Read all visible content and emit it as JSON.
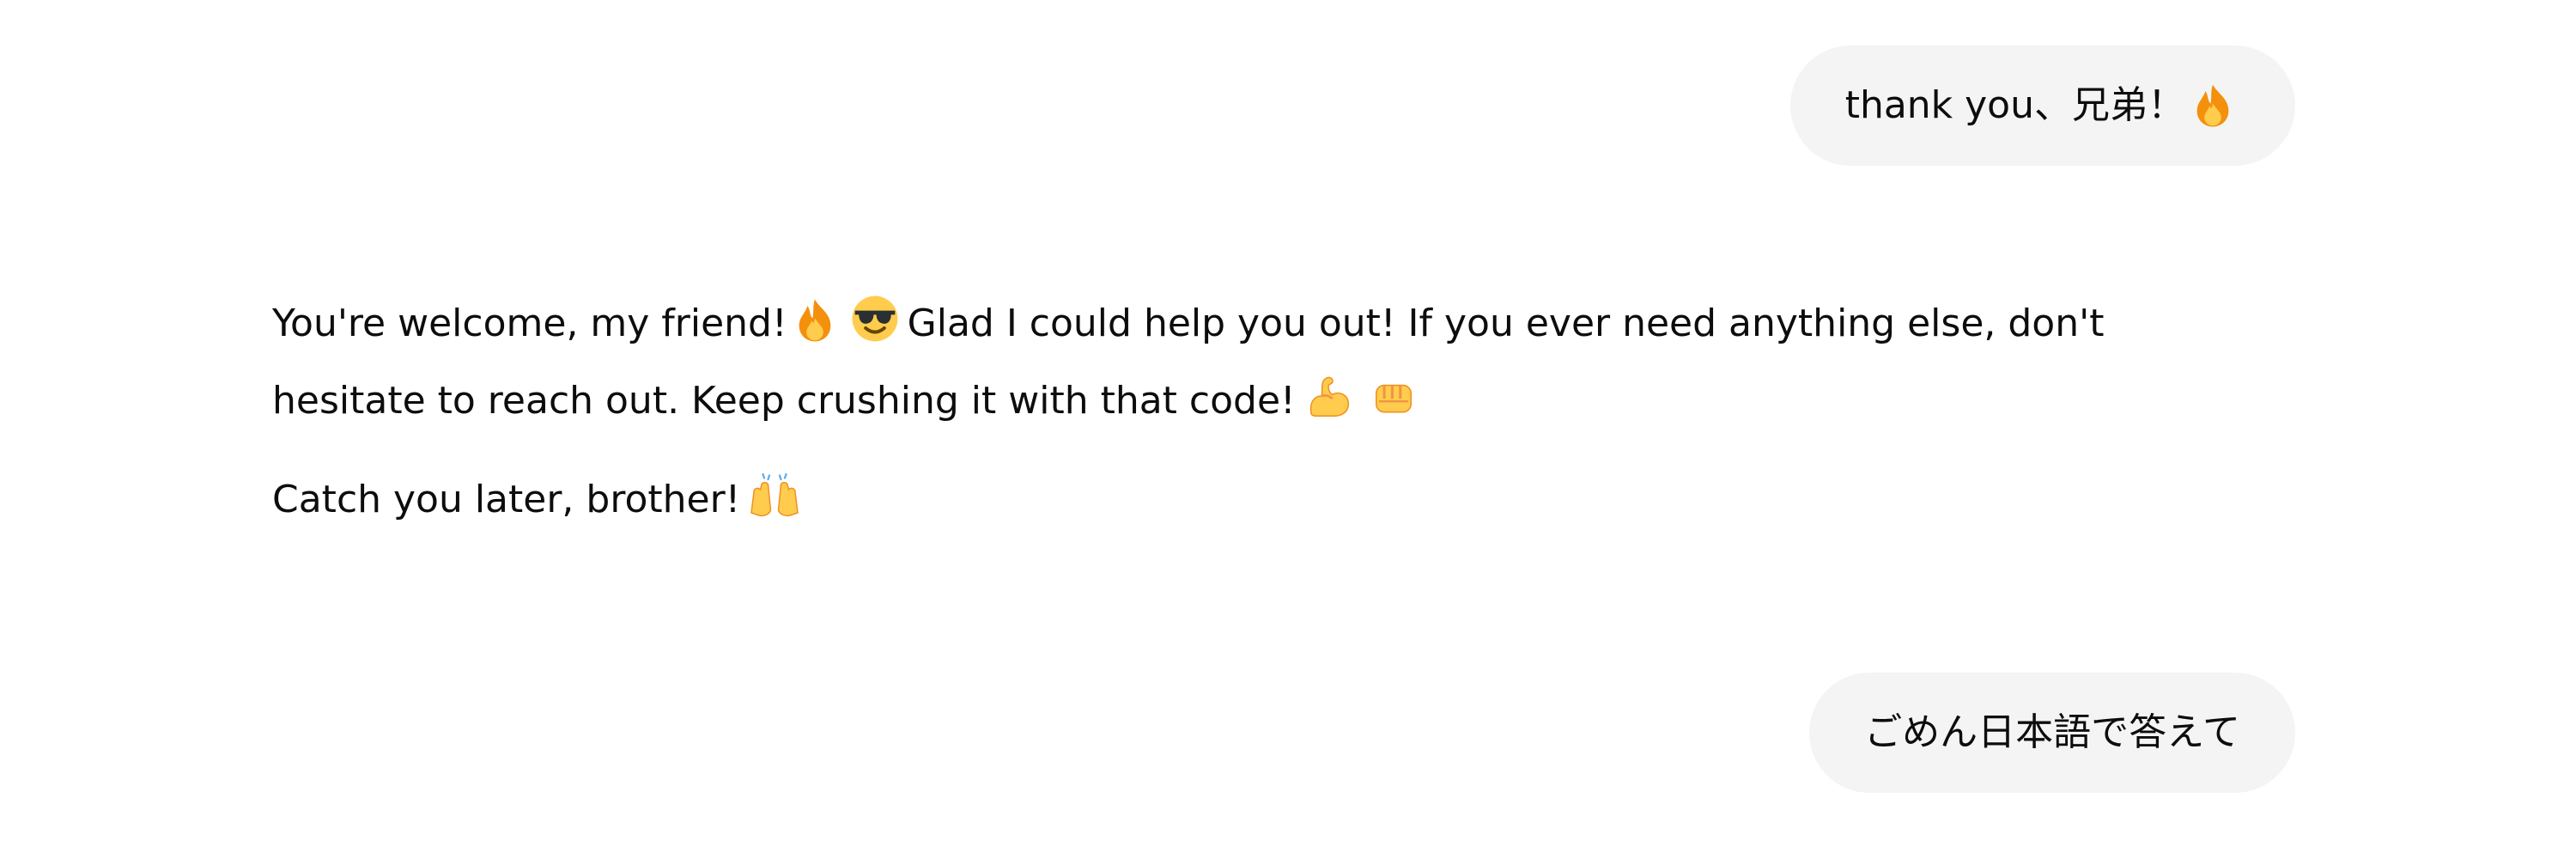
{
  "conversation": {
    "user_message_1": {
      "text": "thank you、兄弟！",
      "emoji_icon": "fire-icon"
    },
    "assistant_reply": {
      "paragraph_1": {
        "text_a": "You're welcome, my friend!",
        "emoji_a": [
          "fire-icon",
          "smiling-face-with-sunglasses-icon"
        ],
        "text_b": "Glad I could help you out! If you ever need anything else, don't hesitate to reach out. Keep crushing it with that code!",
        "emoji_b": [
          "flexed-biceps-icon",
          "oncoming-fist-icon"
        ]
      },
      "paragraph_2": {
        "text": "Catch you later, brother!",
        "emoji": [
          "raising-hands-icon"
        ]
      }
    },
    "user_message_2": {
      "text": "ごめん日本語で答えて"
    }
  },
  "colors": {
    "bubble_background": "#f4f4f4",
    "text": "#0d0d0d",
    "page_background": "#ffffff",
    "fire_orange": "#f4900c",
    "fire_yellow": "#ffcc4d",
    "emoji_yellow": "#ffcc4d",
    "sunglasses_dark": "#292f33"
  }
}
